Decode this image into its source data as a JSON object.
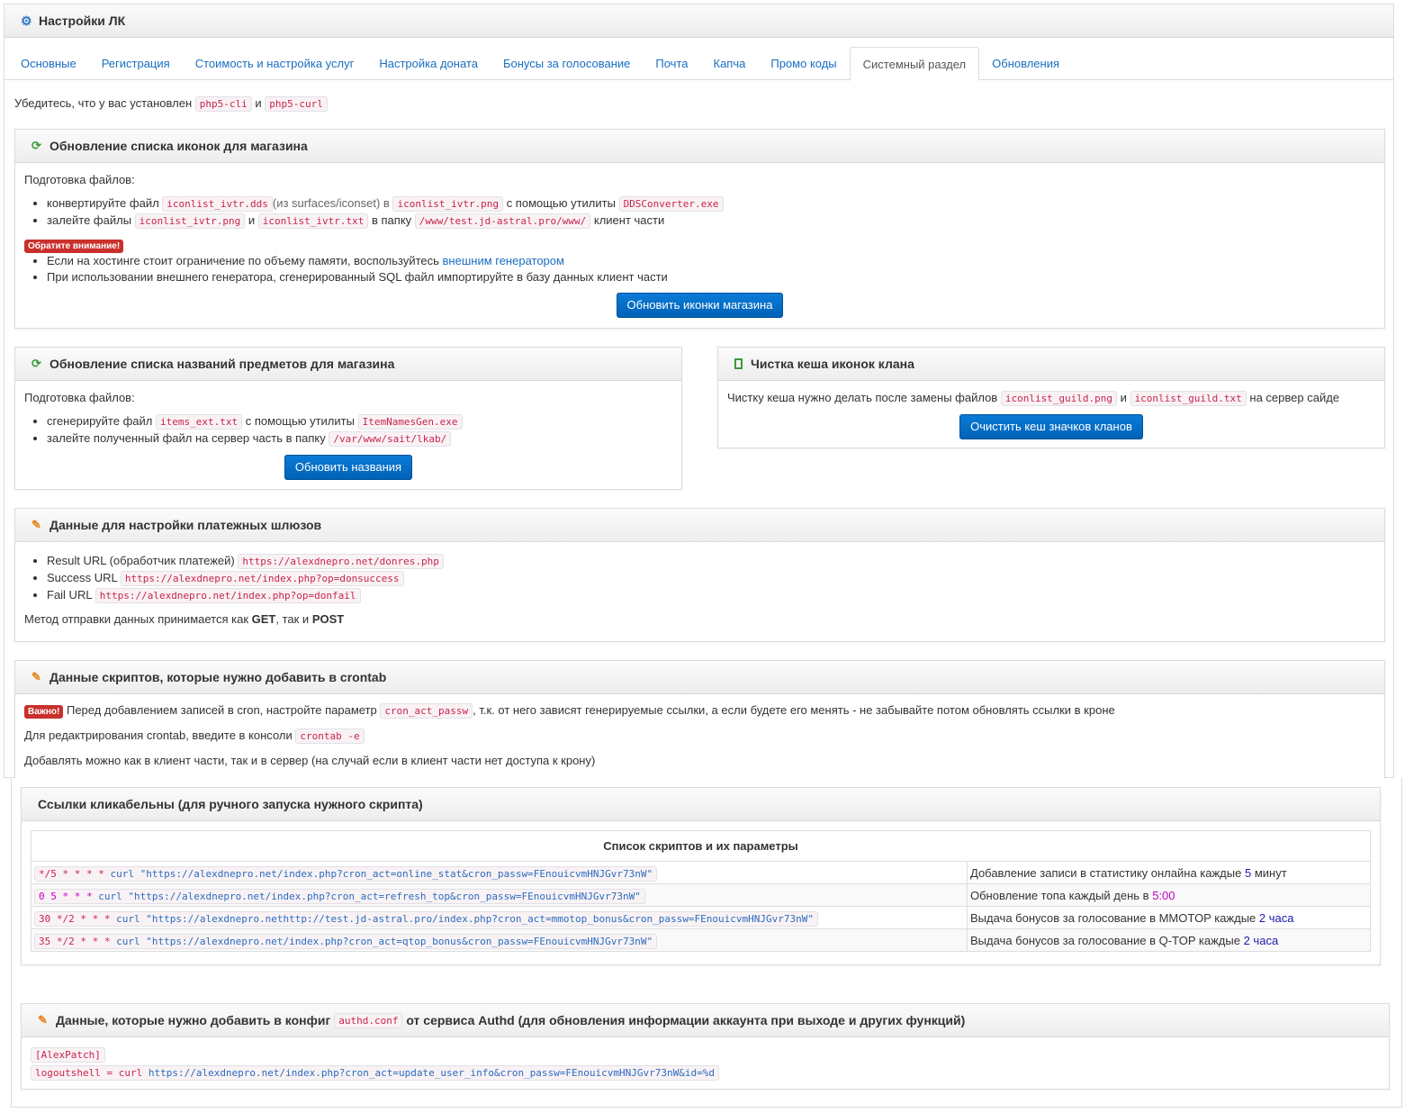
{
  "header": {
    "title": "Настройки ЛК",
    "icon": "gear-icon"
  },
  "tabs": [
    {
      "label": "Основные"
    },
    {
      "label": "Регистрация"
    },
    {
      "label": "Стоимость и настройка услуг"
    },
    {
      "label": "Настройка доната"
    },
    {
      "label": "Бонусы за голосование"
    },
    {
      "label": "Почта"
    },
    {
      "label": "Капча"
    },
    {
      "label": "Промо коды"
    },
    {
      "label": "Системный раздел"
    },
    {
      "label": "Обновления"
    }
  ],
  "active_tab": "Системный раздел",
  "intro": {
    "text": "Убедитесь, что у вас установлен",
    "code1": "php5-cli",
    "and": "и",
    "code2": "php5-curl"
  },
  "icons_panel": {
    "title": "Обновление списка иконок для магазина",
    "prep": "Подготовка файлов:",
    "li1": {
      "t1": "конвертируйте файл",
      "c1": "iconlist_ivtr.dds",
      "t2": "(из surfaces/iconset) в",
      "c2": "iconlist_ivtr.png",
      "t3": "с помощью утилиты",
      "c3": "DDSConverter.exe"
    },
    "li2": {
      "t1": "залейте файлы",
      "c1": "iconlist_ivtr.png",
      "t2": "и",
      "c2": "iconlist_ivtr.txt",
      "t3": "в папку",
      "c3": "/www/test.jd-astral.pro/www/",
      "t4": "клиент части"
    },
    "warning_label": "Обратите внимание!",
    "w1": {
      "text": "Если на хостинге стоит ограничение по объему памяти, воспользуйтесь",
      "link": "внешним генератором"
    },
    "w2": "При использовании внешнего генератора, сгенерированный SQL файл импортируйте в базу данных клиент части",
    "button": "Обновить иконки магазина"
  },
  "names_panel": {
    "title": "Обновление списка названий предметов для магазина",
    "prep": "Подготовка файлов:",
    "li1": {
      "t1": "сгенерируйте файл",
      "c1": "items_ext.txt",
      "t2": "с помощью утилиты",
      "c2": "ItemNamesGen.exe"
    },
    "li2": {
      "t1": "залейте полученный файл на сервер часть в папку",
      "c1": "/var/www/sait/lkab/"
    },
    "button": "Обновить названия"
  },
  "clan_panel": {
    "title": "Чистка кеша иконок клана",
    "t1": "Чистку кеша нужно делать после замены файлов",
    "c1": "iconlist_guild.png",
    "t2": "и",
    "c2": "iconlist_guild.txt",
    "t3": "на сервер сайде",
    "button": "Очистить кеш значков кланов"
  },
  "payments_panel": {
    "title": "Данные для настройки платежных шлюзов",
    "items": [
      {
        "label": "Result URL (обработчик платежей)",
        "url": "https://alexdnepro.net/donres.php"
      },
      {
        "label": "Success URL",
        "url": "https://alexdnepro.net/index.php?op=donsuccess"
      },
      {
        "label": "Fail URL",
        "url": "https://alexdnepro.net/index.php?op=donfail"
      }
    ],
    "method_text": "Метод отправки данных принимается как",
    "get": "GET",
    "and": ", так и",
    "post": "POST"
  },
  "cron_panel": {
    "title": "Данные скриптов, которые нужно добавить в crontab",
    "important_label": "Важно!",
    "important_t1": "Перед добавлением записей в cron, настройте параметр",
    "important_code": "cron_act_passw",
    "important_t2": ", т.к. от него зависят генерируемые ссылки, а если будете его менять - не забывайте потом обновлять ссылки в кроне",
    "edit_t": "Для редактрирования crontab, введите в консоли",
    "edit_code": "crontab -e",
    "add_t": "Добавлять можно как в клиент части, так и в сервер (на случай если в клиент части нет доступа к крону)"
  },
  "links_panel": {
    "title": "Ссылки кликабельны (для ручного запуска нужного скрипта)",
    "table_title": "Список скриптов и их параметры",
    "rows": [
      {
        "sched": "*/5 * * * *",
        "url": "\"https://alexdnepro.net/index.php?cron_act=online_stat&cron_passw=FEnouicvmHNJGvr73nW\"",
        "d1": "Добавление записи в статистику онлайна каждые",
        "n": "5",
        "d2": "минут"
      },
      {
        "sched": "0 5 * * *",
        "url": "\"https://alexdnepro.net/index.php?cron_act=refresh_top&cron_passw=FEnouicvmHNJGvr73nW\"",
        "d1": "Обновление топа каждый день в",
        "n": "5:00",
        "d2": ""
      },
      {
        "sched": "30 */2 * * *",
        "url": "\"https://alexdnepro.nethttp://test.jd-astral.pro/index.php?cron_act=mmotop_bonus&cron_passw=FEnouicvmHNJGvr73nW\"",
        "d1": "Выдача бонусов за голосование в MMOTOP каждые",
        "n": "2 часа",
        "d2": ""
      },
      {
        "sched": "35 */2 * * *",
        "url": "\"https://alexdnepro.net/index.php?cron_act=qtop_bonus&cron_passw=FEnouicvmHNJGvr73nW\"",
        "d1": "Выдача бонусов за голосование в Q-TOP каждые",
        "n": "2 часа",
        "d2": ""
      }
    ],
    "curl": "curl"
  },
  "authd_panel": {
    "title_t1": "Данные, которые нужно добавить в конфиг",
    "title_code": "authd.conf",
    "title_t2": "от сервиса Authd (для обновления информации аккаунта при выходе и других функций)",
    "line1": "[AlexPatch]",
    "line2_prefix": "logoutshell = curl",
    "line2_url": "https://alexdnepro.net/index.php?cron_act=update_user_info&cron_passw=FEnouicvmHNJGvr73nW&id=%d"
  }
}
